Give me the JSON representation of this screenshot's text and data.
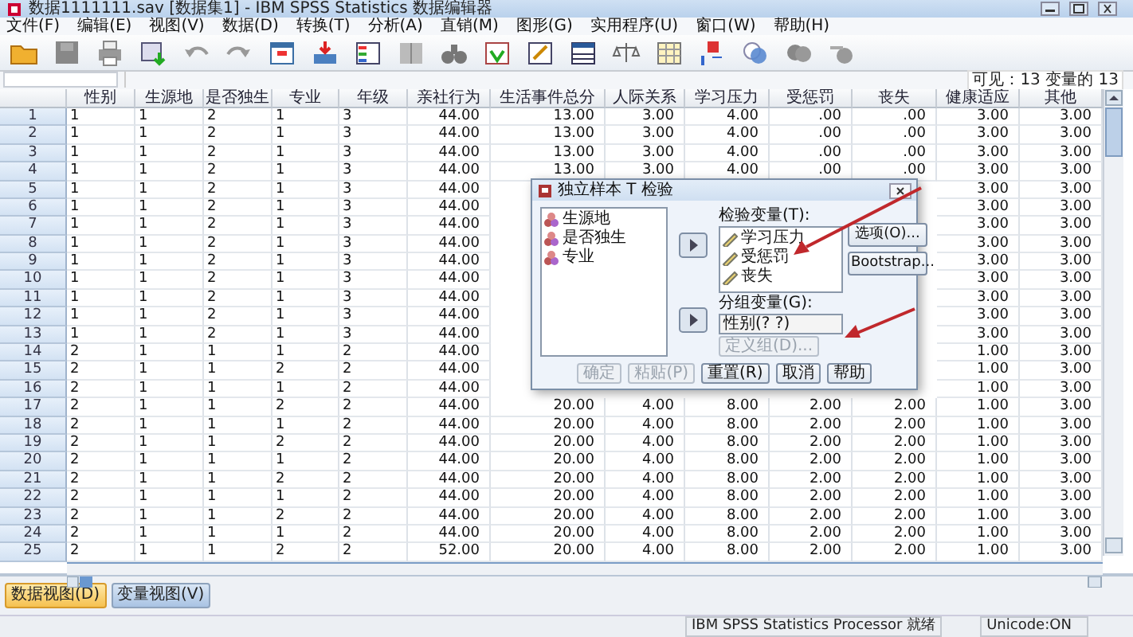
{
  "window": {
    "title": "数据1111111.sav [数据集1] - IBM SPSS Statistics 数据编辑器"
  },
  "menu": [
    "文件(F)",
    "编辑(E)",
    "视图(V)",
    "数据(D)",
    "转换(T)",
    "分析(A)",
    "直销(M)",
    "图形(G)",
    "实用程序(U)",
    "窗口(W)",
    "帮助(H)"
  ],
  "info": "可见：13 变量的 13",
  "table": {
    "columns": [
      "性别",
      "生源地",
      "是否独生",
      "专业",
      "年级",
      "亲社行为",
      "生活事件总分",
      "人际关系",
      "学习压力",
      "受惩罚",
      "丧失",
      "健康适应",
      "其他"
    ],
    "rows": [
      {
        "number": "1",
        "cells": [
          "1",
          "1",
          "2",
          "1",
          "3",
          "44.00",
          "13.00",
          "3.00",
          "4.00",
          ".00",
          ".00",
          "3.00",
          "3.00"
        ]
      },
      {
        "number": "2",
        "cells": [
          "1",
          "1",
          "2",
          "1",
          "3",
          "44.00",
          "13.00",
          "3.00",
          "4.00",
          ".00",
          ".00",
          "3.00",
          "3.00"
        ]
      },
      {
        "number": "3",
        "cells": [
          "1",
          "1",
          "2",
          "1",
          "3",
          "44.00",
          "13.00",
          "3.00",
          "4.00",
          ".00",
          ".00",
          "3.00",
          "3.00"
        ]
      },
      {
        "number": "4",
        "cells": [
          "1",
          "1",
          "2",
          "1",
          "3",
          "44.00",
          "13.00",
          "3.00",
          "4.00",
          ".00",
          ".00",
          "3.00",
          "3.00"
        ]
      },
      {
        "number": "5",
        "cells": [
          "1",
          "1",
          "2",
          "1",
          "3",
          "44.00",
          null,
          null,
          null,
          null,
          null,
          "3.00",
          "3.00"
        ]
      },
      {
        "number": "6",
        "cells": [
          "1",
          "1",
          "2",
          "1",
          "3",
          "44.00",
          null,
          null,
          null,
          null,
          null,
          "3.00",
          "3.00"
        ]
      },
      {
        "number": "7",
        "cells": [
          "1",
          "1",
          "2",
          "1",
          "3",
          "44.00",
          null,
          null,
          null,
          null,
          null,
          "3.00",
          "3.00"
        ]
      },
      {
        "number": "8",
        "cells": [
          "1",
          "1",
          "2",
          "1",
          "3",
          "44.00",
          null,
          null,
          null,
          null,
          null,
          "3.00",
          "3.00"
        ]
      },
      {
        "number": "9",
        "cells": [
          "1",
          "1",
          "2",
          "1",
          "3",
          "44.00",
          null,
          null,
          null,
          null,
          null,
          "3.00",
          "3.00"
        ]
      },
      {
        "number": "10",
        "cells": [
          "1",
          "1",
          "2",
          "1",
          "3",
          "44.00",
          null,
          null,
          null,
          null,
          null,
          "3.00",
          "3.00"
        ]
      },
      {
        "number": "11",
        "cells": [
          "1",
          "1",
          "2",
          "1",
          "3",
          "44.00",
          null,
          null,
          null,
          null,
          null,
          "3.00",
          "3.00"
        ]
      },
      {
        "number": "12",
        "cells": [
          "1",
          "1",
          "2",
          "1",
          "3",
          "44.00",
          null,
          null,
          null,
          null,
          null,
          "3.00",
          "3.00"
        ]
      },
      {
        "number": "13",
        "cells": [
          "1",
          "1",
          "2",
          "1",
          "3",
          "44.00",
          null,
          null,
          null,
          null,
          null,
          "3.00",
          "3.00"
        ]
      },
      {
        "number": "14",
        "cells": [
          "2",
          "1",
          "1",
          "1",
          "2",
          "44.00",
          null,
          null,
          null,
          null,
          null,
          "1.00",
          "3.00"
        ]
      },
      {
        "number": "15",
        "cells": [
          "2",
          "1",
          "1",
          "2",
          "2",
          "44.00",
          null,
          null,
          null,
          null,
          null,
          "1.00",
          "3.00"
        ]
      },
      {
        "number": "16",
        "cells": [
          "2",
          "1",
          "1",
          "1",
          "2",
          "44.00",
          null,
          null,
          null,
          null,
          null,
          "1.00",
          "3.00"
        ]
      },
      {
        "number": "17",
        "cells": [
          "2",
          "1",
          "1",
          "2",
          "2",
          "44.00",
          "20.00",
          "4.00",
          "8.00",
          "2.00",
          "2.00",
          "1.00",
          "3.00"
        ]
      },
      {
        "number": "18",
        "cells": [
          "2",
          "1",
          "1",
          "1",
          "2",
          "44.00",
          "20.00",
          "4.00",
          "8.00",
          "2.00",
          "2.00",
          "1.00",
          "3.00"
        ]
      },
      {
        "number": "19",
        "cells": [
          "2",
          "1",
          "1",
          "2",
          "2",
          "44.00",
          "20.00",
          "4.00",
          "8.00",
          "2.00",
          "2.00",
          "1.00",
          "3.00"
        ]
      },
      {
        "number": "20",
        "cells": [
          "2",
          "1",
          "1",
          "1",
          "2",
          "44.00",
          "20.00",
          "4.00",
          "8.00",
          "2.00",
          "2.00",
          "1.00",
          "3.00"
        ]
      },
      {
        "number": "21",
        "cells": [
          "2",
          "1",
          "1",
          "2",
          "2",
          "44.00",
          "20.00",
          "4.00",
          "8.00",
          "2.00",
          "2.00",
          "1.00",
          "3.00"
        ]
      },
      {
        "number": "22",
        "cells": [
          "2",
          "1",
          "1",
          "1",
          "2",
          "44.00",
          "20.00",
          "4.00",
          "8.00",
          "2.00",
          "2.00",
          "1.00",
          "3.00"
        ]
      },
      {
        "number": "23",
        "cells": [
          "2",
          "1",
          "1",
          "2",
          "2",
          "44.00",
          "20.00",
          "4.00",
          "8.00",
          "2.00",
          "2.00",
          "1.00",
          "3.00"
        ]
      },
      {
        "number": "24",
        "cells": [
          "2",
          "1",
          "1",
          "1",
          "2",
          "44.00",
          "20.00",
          "4.00",
          "8.00",
          "2.00",
          "2.00",
          "1.00",
          "3.00"
        ]
      },
      {
        "number": "25",
        "cells": [
          "2",
          "1",
          "1",
          "2",
          "2",
          "52.00",
          "20.00",
          "4.00",
          "8.00",
          "2.00",
          "2.00",
          "1.00",
          "3.00"
        ]
      }
    ]
  },
  "dialog": {
    "title": "独立样本 T 检验",
    "source_variables": [
      "生源地",
      "是否独生",
      "专业"
    ],
    "test_variables_label": "检验变量(T):",
    "test_variables": [
      "学习压力",
      "受惩罚",
      "丧失"
    ],
    "grouping_label": "分组变量(G):",
    "grouping_value": "性别(? ?)",
    "define_groups": {
      "label": "定义组(D)...",
      "disabled": true
    },
    "side_buttons": [
      "选项(O)...",
      "Bootstrap..."
    ],
    "buttons": [
      {
        "label": "确定",
        "disabled": true
      },
      {
        "label": "粘贴(P)",
        "disabled": true
      },
      {
        "label": "重置(R)",
        "disabled": false
      },
      {
        "label": "取消",
        "disabled": false
      },
      {
        "label": "帮助",
        "disabled": false
      }
    ]
  },
  "view_tabs": [
    {
      "label": "数据视图(D)",
      "selected": true
    },
    {
      "label": "变量视图(V)",
      "selected": false
    }
  ],
  "status_bar": {
    "processor": "IBM SPSS Statistics Processor 就绪",
    "encoding": "Unicode:ON"
  }
}
